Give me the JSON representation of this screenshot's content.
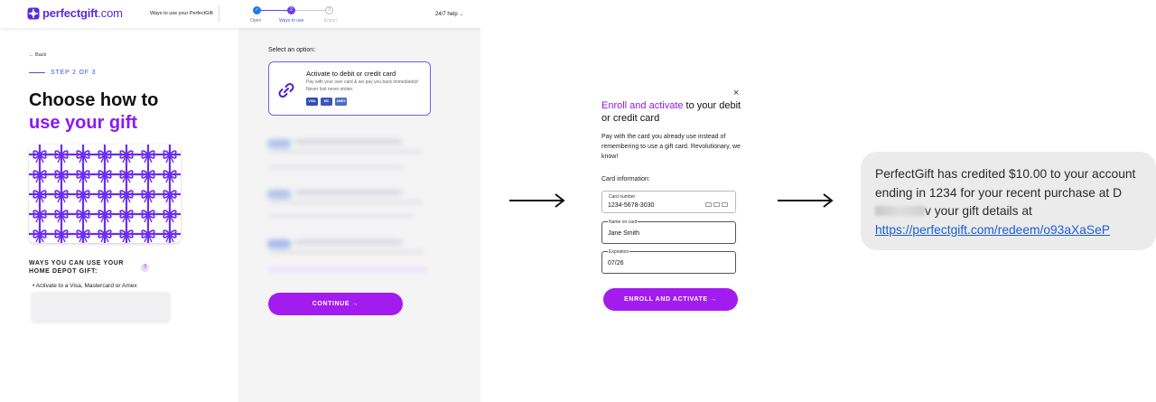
{
  "site": {
    "logo_text": "perfectgift",
    "logo_suffix": ".com",
    "nav_link": "Ways to use your PerfectGift",
    "help": "24/7 help",
    "steps": [
      {
        "number": "",
        "label": "Open"
      },
      {
        "number": "2",
        "label": "Ways to use"
      },
      {
        "number": "3",
        "label": "Enjoy!"
      }
    ]
  },
  "left": {
    "back": "Back",
    "step_label": "STEP 2 OF 3",
    "headline_line1": "Choose how to",
    "headline_line2": "use your gift",
    "ways_title": "WAYS YOU CAN USE YOUR HOME DEPOT GIFT:",
    "ways_help": "?",
    "ways_item": "Activate to a Visa, Mastercard or Amex"
  },
  "options": {
    "select_label": "Select an option:",
    "selected_title": "Activate to debit or credit card",
    "selected_desc": "Pay with your own card & we pay you back immediately! Never lost never stolen.",
    "card_logos": [
      "VISA",
      "MC",
      "AMEX"
    ],
    "continue_label": "CONTINUE →"
  },
  "modal": {
    "title_accent": "Enroll and activate",
    "title_rest": " to your debit or credit card",
    "description": "Pay with the card you already use instead of remembering to use a gift card. Revolutionary, we know!",
    "section_label": "Card information:",
    "fields": [
      {
        "label": "Card number",
        "value": "1234-5678-3030"
      },
      {
        "label": "Name on card",
        "value": "Jane Smith"
      },
      {
        "label": "Expiration",
        "value": "07/26"
      }
    ],
    "button_label": "ENROLL AND ACTIVATE →",
    "close": "×"
  },
  "sms": {
    "text_before": "PerfectGift has credited $10.00 to your account ending in 1234 for your recent purchase at D",
    "text_after": "v your gift details at",
    "link": "https://perfectgift.com/redeem/o93aXaSeP"
  },
  "colors": {
    "brand_purple": "#a21cf0",
    "accent_violet": "#8a1af0",
    "step_blue": "#3a59d8",
    "link_blue": "#1a5fd8"
  }
}
